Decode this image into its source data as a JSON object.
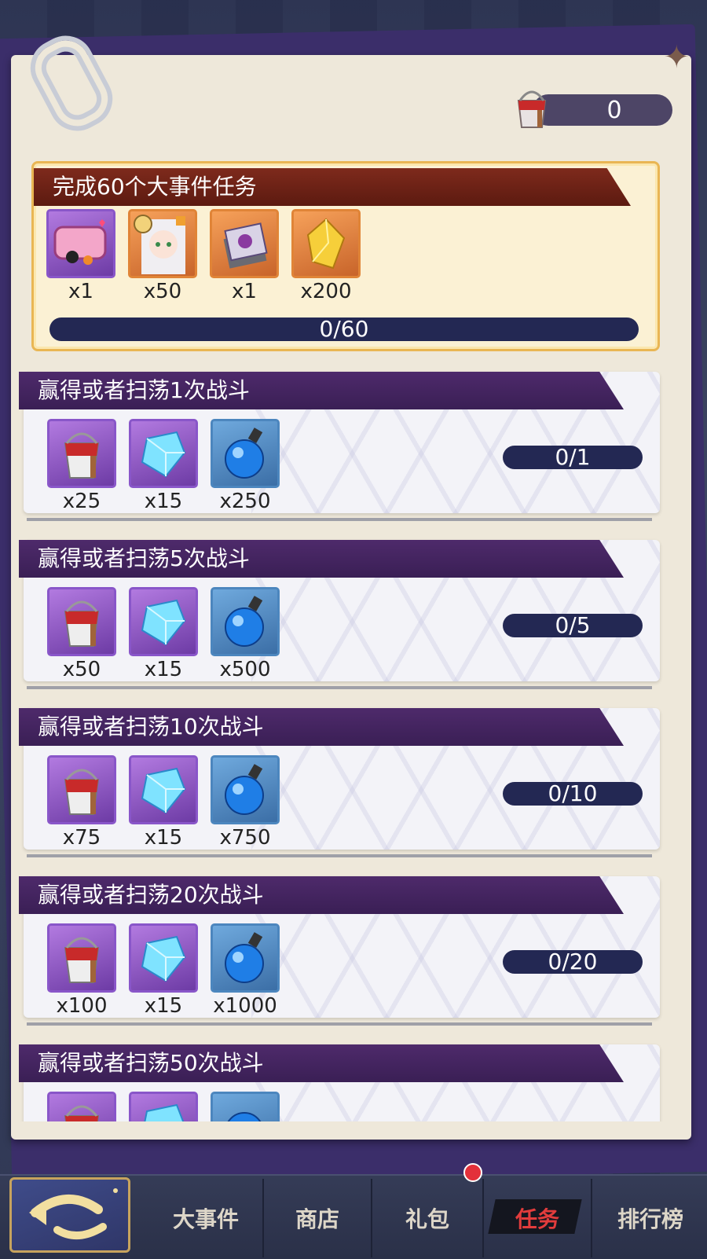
{
  "currency": {
    "value": "0"
  },
  "main_task": {
    "title": "完成60个大事件任务",
    "rewards": [
      {
        "qty": "x1",
        "frame": "purple",
        "icon": "name-plate-icon"
      },
      {
        "qty": "x50",
        "frame": "orange",
        "icon": "character-shard-icon"
      },
      {
        "qty": "x1",
        "frame": "orange",
        "icon": "card-pack-icon"
      },
      {
        "qty": "x200",
        "frame": "orange",
        "icon": "gold-crystal-icon"
      }
    ],
    "progress": "0/60"
  },
  "tasks": [
    {
      "title": "赢得或者扫荡1次战斗",
      "rewards": [
        "x25",
        "x15",
        "x250"
      ],
      "progress": "0/1"
    },
    {
      "title": "赢得或者扫荡5次战斗",
      "rewards": [
        "x50",
        "x15",
        "x500"
      ],
      "progress": "0/5"
    },
    {
      "title": "赢得或者扫荡10次战斗",
      "rewards": [
        "x75",
        "x15",
        "x750"
      ],
      "progress": "0/10"
    },
    {
      "title": "赢得或者扫荡20次战斗",
      "rewards": [
        "x100",
        "x15",
        "x1000"
      ],
      "progress": "0/20"
    },
    {
      "title": "赢得或者扫荡50次战斗",
      "rewards": [
        "",
        "",
        ""
      ],
      "progress": ""
    }
  ],
  "tabs": [
    {
      "label": "大事件"
    },
    {
      "label": "商店"
    },
    {
      "label": "礼包"
    },
    {
      "label": "任务"
    },
    {
      "label": "排行榜"
    }
  ],
  "colors": {
    "accent_red": "#e23c3c",
    "banner_purple": "#3a1f55",
    "banner_brown": "#6d2214",
    "progress_bg": "#232853"
  }
}
